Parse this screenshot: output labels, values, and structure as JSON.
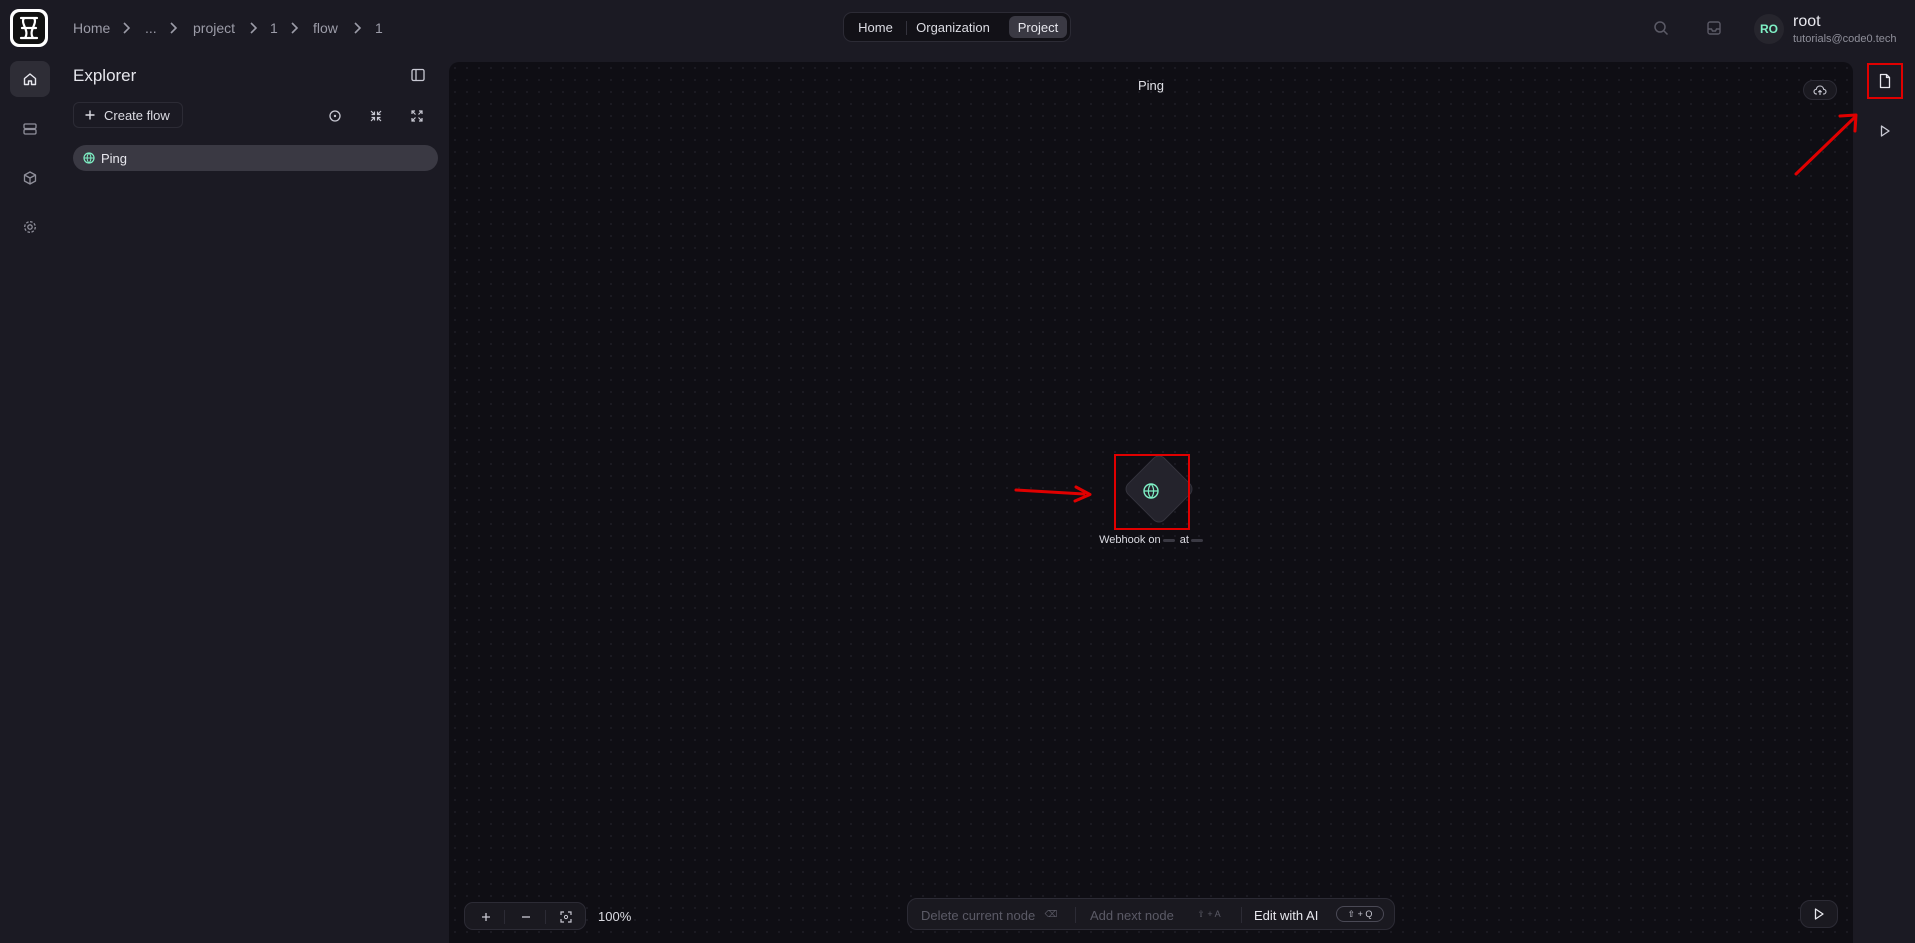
{
  "breadcrumb": [
    "Home",
    "...",
    "project",
    "1",
    "flow",
    "1"
  ],
  "tabs": [
    {
      "label": "Home",
      "active": false
    },
    {
      "label": "Organization",
      "active": false
    },
    {
      "label": "Project",
      "active": true
    }
  ],
  "user": {
    "initials": "RO",
    "name": "root",
    "email": "tutorials@code0.tech"
  },
  "rail": {
    "icons": [
      "home-icon",
      "database-icon",
      "cube-icon",
      "gear-icon"
    ],
    "active": "home-icon"
  },
  "explorer": {
    "title": "Explorer",
    "create_label": "Create flow",
    "flows": [
      {
        "name": "Ping",
        "icon": "globe-icon"
      }
    ]
  },
  "canvas": {
    "title": "Ping",
    "node": {
      "label_start": "Webhook on",
      "label_mid": "at",
      "icon": "globe-icon"
    }
  },
  "zoom": {
    "level": "100%"
  },
  "actions": {
    "delete_label": "Delete current node",
    "delete_key": "⌫",
    "add_label": "Add next node",
    "add_keys": "⇧ + A",
    "edit_ai_label": "Edit with AI",
    "edit_ai_keys": "⇧ + Q"
  },
  "colors": {
    "accent": "#7ff0c5",
    "highlight": "#e00000",
    "canvas_bg": "#0f0e14",
    "app_bg": "#1b1a23"
  }
}
